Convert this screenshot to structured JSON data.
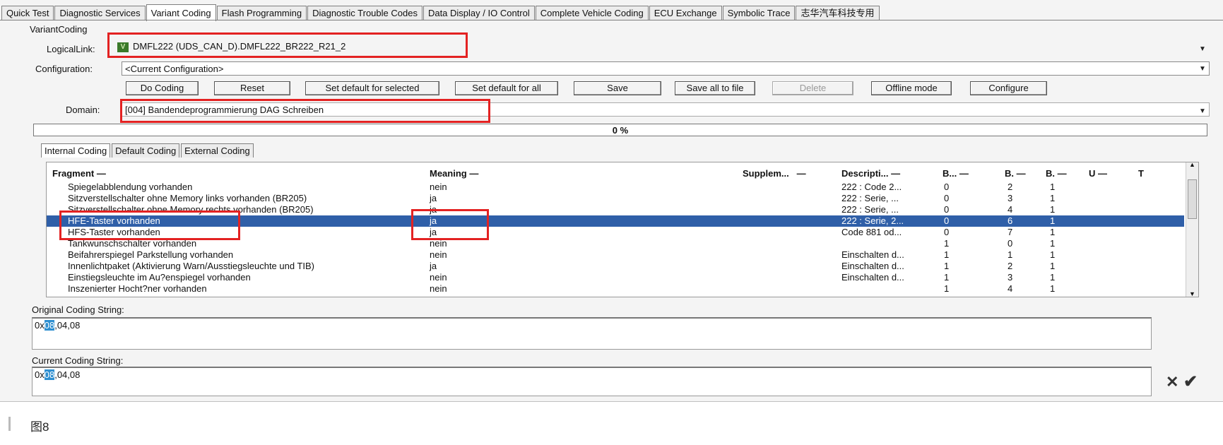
{
  "tabs": [
    "Quick Test",
    "Diagnostic Services",
    "Variant Coding",
    "Flash Programming",
    "Diagnostic Trouble Codes",
    "Data Display / IO Control",
    "Complete Vehicle Coding",
    "ECU Exchange",
    "Symbolic Trace",
    "志华汽车科技专用"
  ],
  "active_tab": "Variant Coding",
  "section_title": "VariantCoding",
  "logical_link": {
    "label": "LogicalLink:",
    "badge": "V",
    "value": "DMFL222 (UDS_CAN_D).DMFL222_BR222_R21_2"
  },
  "configuration": {
    "label": "Configuration:",
    "value": "<Current Configuration>"
  },
  "buttons": [
    "Do Coding",
    "Reset",
    "Set default for selected",
    "Set default for all",
    "Save",
    "Save all to file",
    "Delete",
    "Offline mode",
    "Configure"
  ],
  "domain": {
    "label": "Domain:",
    "value": "[004] Bandendeprogrammierung DAG Schreiben"
  },
  "progress": {
    "value": 0,
    "text": "0 %"
  },
  "subtabs": [
    "Internal Coding",
    "Default Coding",
    "External Coding"
  ],
  "table": {
    "headers": [
      "Fragment",
      "Meaning",
      "Supplem...",
      "Descripti...",
      "B...",
      "B.",
      "B.",
      "U",
      "T"
    ],
    "rows": [
      {
        "fragment": "Spiegelabblendung vorhanden",
        "meaning": "nein",
        "desc": "222 : Code 2...",
        "b1": "0",
        "b2": "2",
        "b3": "1"
      },
      {
        "fragment": "Sitzverstellschalter ohne Memory links vorhanden (BR205)",
        "meaning": "ja",
        "desc": "222 : Serie, ...",
        "b1": "0",
        "b2": "3",
        "b3": "1"
      },
      {
        "fragment": "Sitzverstellschalter ohne Memory rechts vorhanden (BR205)",
        "meaning": "ja",
        "desc": "222 : Serie, ...",
        "b1": "0",
        "b2": "4",
        "b3": "1"
      },
      {
        "fragment": "HFE-Taster vorhanden",
        "meaning": "ja",
        "desc": "222 : Serie, 2...",
        "b1": "0",
        "b2": "6",
        "b3": "1",
        "selected": true
      },
      {
        "fragment": "HFS-Taster vorhanden",
        "meaning": "ja",
        "desc": "Code 881 od...",
        "b1": "0",
        "b2": "7",
        "b3": "1"
      },
      {
        "fragment": "Tankwunschschalter vorhanden",
        "meaning": "nein",
        "desc": "",
        "b1": "1",
        "b2": "0",
        "b3": "1"
      },
      {
        "fragment": "Beifahrerspiegel Parkstellung vorhanden",
        "meaning": "nein",
        "desc": "Einschalten d...",
        "b1": "1",
        "b2": "1",
        "b3": "1"
      },
      {
        "fragment": "Innenlichtpaket (Aktivierung Warn/Ausstiegsleuchte und TIB)",
        "meaning": "ja",
        "desc": "Einschalten d...",
        "b1": "1",
        "b2": "2",
        "b3": "1"
      },
      {
        "fragment": "Einstiegsleuchte im Au?enspiegel vorhanden",
        "meaning": "nein",
        "desc": "Einschalten d...",
        "b1": "1",
        "b2": "3",
        "b3": "1"
      },
      {
        "fragment": "Inszenierter Hocht?ner vorhanden",
        "meaning": "nein",
        "desc": "",
        "b1": "1",
        "b2": "4",
        "b3": "1"
      }
    ]
  },
  "original_coding": {
    "label": "Original Coding String:",
    "prefix": "0x",
    "highlight": "08",
    "rest": ",04,08"
  },
  "current_coding": {
    "label": "Current Coding String:",
    "prefix": "0x",
    "highlight": "08",
    "rest": ",04,08"
  },
  "caption": "图8",
  "colors": {
    "selection": "#2f5fa8",
    "annotation": "#e32222",
    "badge": "#3b7a2a"
  }
}
